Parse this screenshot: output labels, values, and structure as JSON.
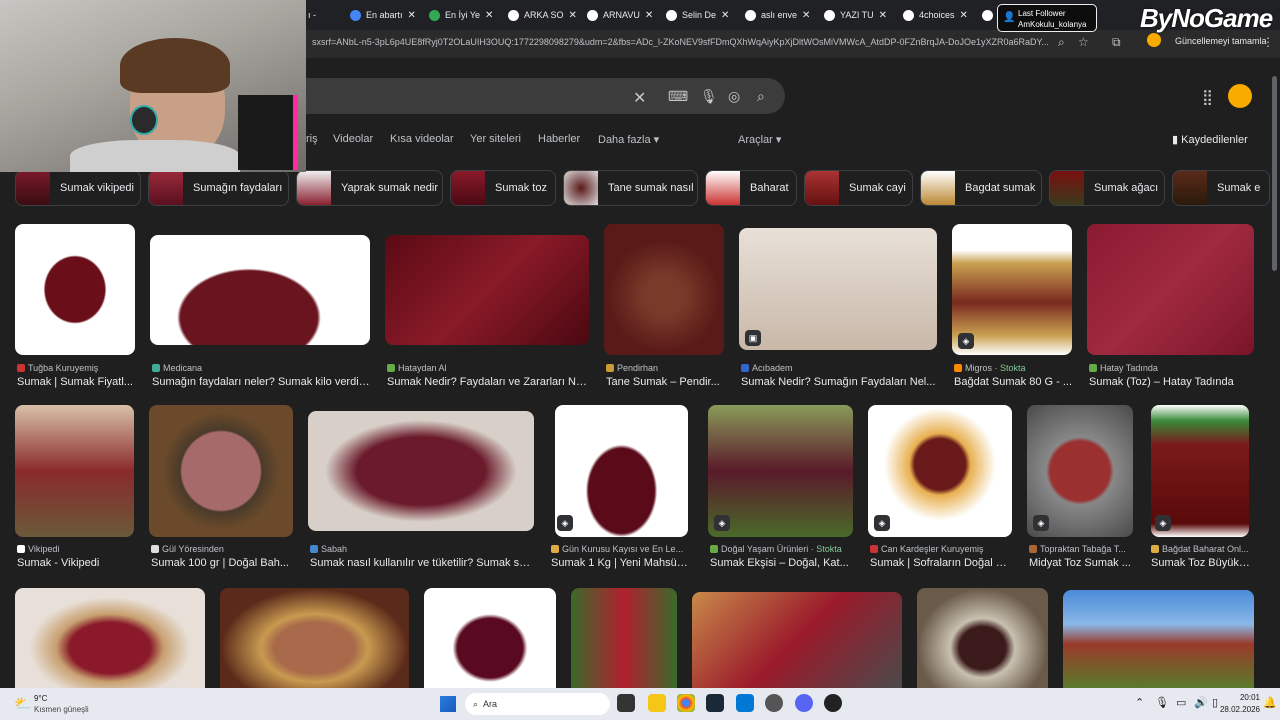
{
  "browser": {
    "tabs": [
      {
        "label": "En abartı",
        "color": "#4285f4"
      },
      {
        "label": "En İyi Ye",
        "color": "#34a853"
      },
      {
        "label": "ARKA SO",
        "color": "#ffffff"
      },
      {
        "label": "ARNAVU",
        "color": "#ffffff"
      },
      {
        "label": "Selin De",
        "color": "#ffffff"
      },
      {
        "label": "aslı enve",
        "color": "#ffffff"
      },
      {
        "label": "YAZI TU",
        "color": "#ffffff"
      },
      {
        "label": "4choices",
        "color": "#ffffff"
      }
    ],
    "url": "sxsrf=ANbL-n5-3pL6p4UE8fRyj0T2OLaUIH3OUQ:1772298098279&udm=2&fbs=ADc_l-ZKoNEV9sfFDmQXhWqAiyKpXjDltWOsMiVMWcA_AtdDP-0FZnBrqJA-DoJOe1yXZR0a6RaDY...",
    "update_label": "Güncellemeyi tamamla"
  },
  "overlay": {
    "title": "Last Follower",
    "name": "AmKokulu_kolanya",
    "logo": "ByNoGame"
  },
  "nav": {
    "items": [
      "Videolar",
      "Kısa videolar",
      "Yer siteleri",
      "Haberler",
      "Daha fazla ▾"
    ],
    "tools": "Araçlar ▾",
    "saved": "Kaydedilenler",
    "partial": "riş"
  },
  "chips": [
    "Sumak vikipedi",
    "Sumağın faydaları",
    "Yaprak sumak nedir",
    "Sumak toz",
    "Tane sumak nasıl",
    "Baharat",
    "Sumak cayi",
    "Bagdat sumak",
    "Sumak ağacı",
    "Sumak e"
  ],
  "results": [
    {
      "source": "Tuğba Kuruyemiş",
      "stock": "",
      "title": "Sumak | Sumak Fiyatl..."
    },
    {
      "source": "Medicana",
      "stock": "",
      "title": "Sumağın faydaları neler? Sumak kilo verdir..."
    },
    {
      "source": "Hataydan Al",
      "stock": "",
      "title": "Sumak Nedir? Faydaları ve Zararları Ne..."
    },
    {
      "source": "Pendirhan",
      "stock": "",
      "title": "Tane Sumak – Pendir..."
    },
    {
      "source": "Acıbadem",
      "stock": "",
      "title": "Sumak Nedir? Sumağın Faydaları Nel..."
    },
    {
      "source": "Migros · ",
      "stock": "Stokta",
      "title": "Bağdat Sumak 80 G - ..."
    },
    {
      "source": "Hatay Tadında",
      "stock": "",
      "title": "Sumak (Toz) – Hatay Tadında"
    },
    {
      "source": "Vikipedi",
      "stock": "",
      "title": "Sumak - Vikipedi"
    },
    {
      "source": "Gül Yöresinden",
      "stock": "",
      "title": "Sumak 100 gr | Doğal Bah..."
    },
    {
      "source": "Sabah",
      "stock": "",
      "title": "Sumak nasıl kullanılır ve tüketilir? Sumak su..."
    },
    {
      "source": "Gün Kurusu Kayısı ve En Le...",
      "stock": "",
      "title": "Sumak 1 Kg | Yeni Mahsül ..."
    },
    {
      "source": "Doğal Yaşam Ürünleri · ",
      "stock": "Stokta",
      "title": "Sumak Ekşisi – Doğal, Kat..."
    },
    {
      "source": "Can Kardeşler Kuruyemiş",
      "stock": "",
      "title": "Sumak | Sofraların Doğal E..."
    },
    {
      "source": "Topraktan Tabağa T...",
      "stock": "",
      "title": "Midyat Toz Sumak ..."
    },
    {
      "source": "Bağdat Baharat Onl...",
      "stock": "",
      "title": "Sumak Toz Büyük ..."
    }
  ],
  "taskbar": {
    "weather_temp": "9°C",
    "weather_desc": "Kısmen güneşli",
    "search": "Ara",
    "time": "20:01",
    "date": "28.02.2026"
  }
}
